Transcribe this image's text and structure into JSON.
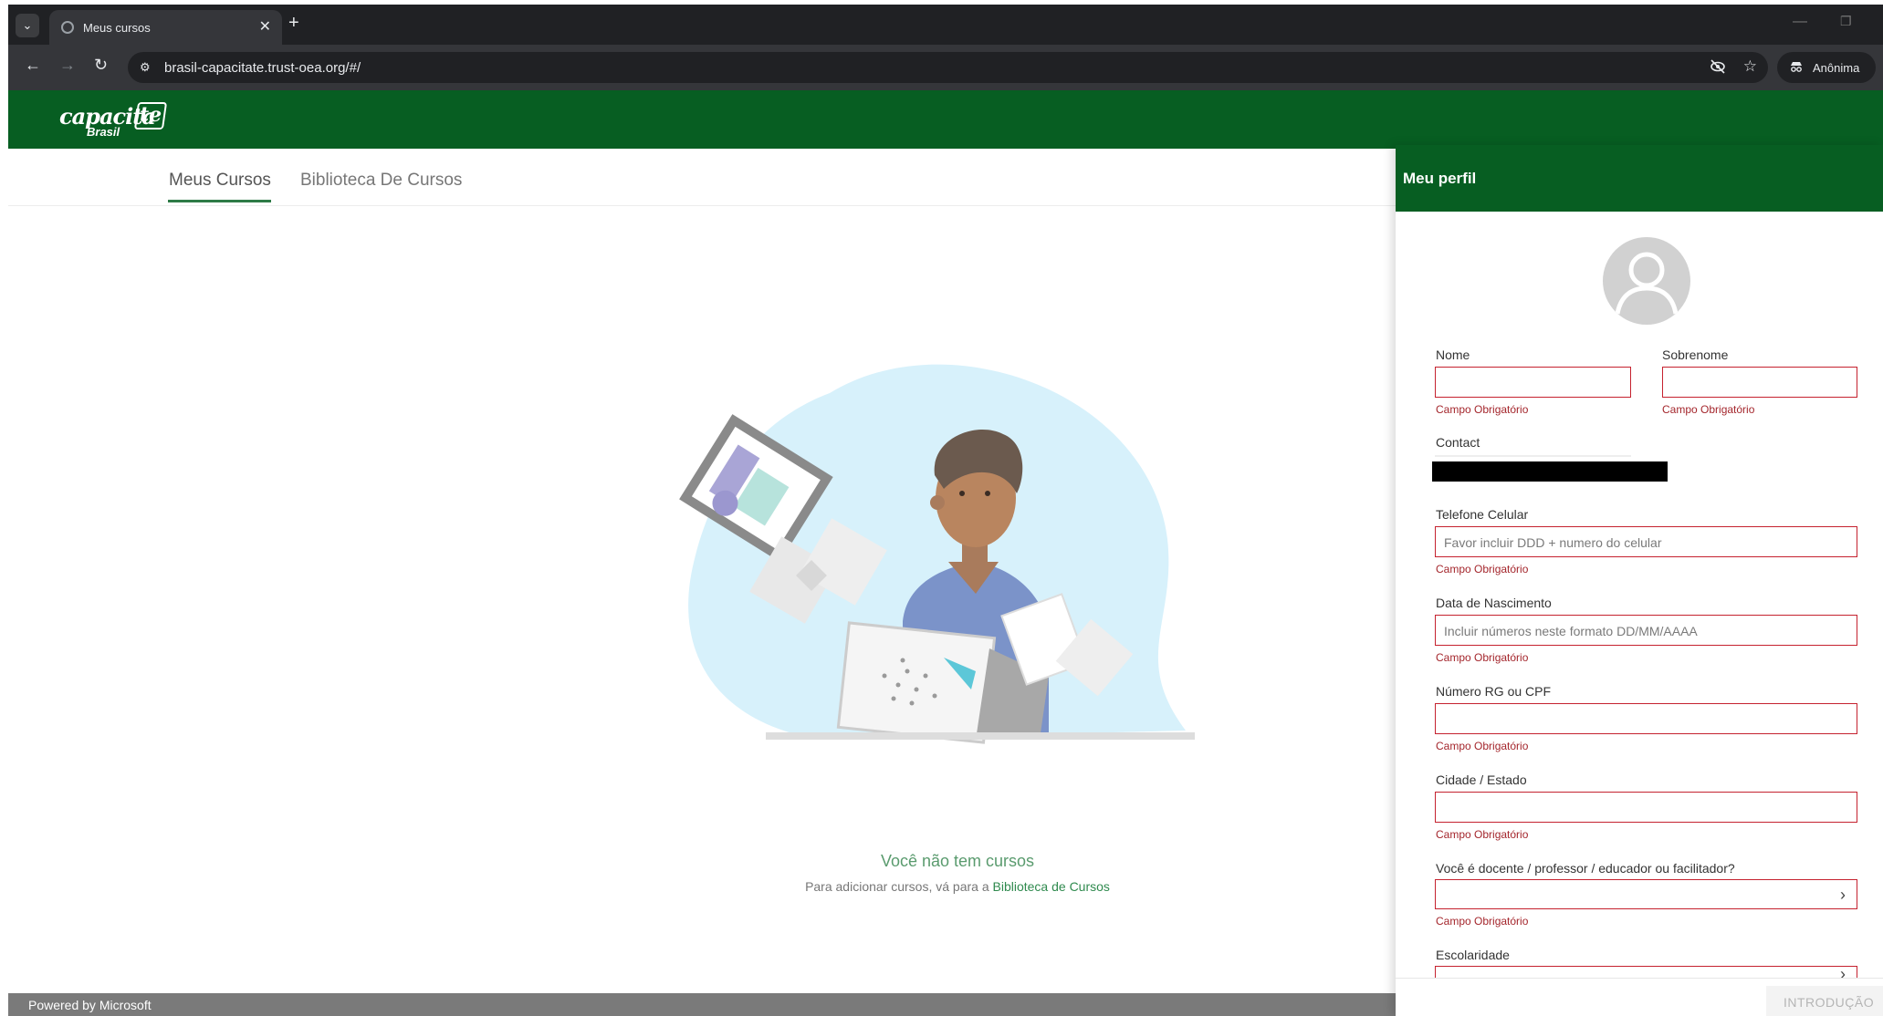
{
  "browser": {
    "tab_title": "Meus cursos",
    "url": "brasil-capacitate.trust-oea.org/#/",
    "profile_label": "Anônima"
  },
  "app": {
    "logo_main": "capacita",
    "logo_accent": "te",
    "logo_sub": "Brasil",
    "brand_color": "#075e22"
  },
  "nav": {
    "tabs": [
      "Meus Cursos",
      "Biblioteca De Cursos"
    ],
    "active_tab": "Meus Cursos"
  },
  "empty_state": {
    "title": "Você não tem cursos",
    "subtitle_prefix": "Para adicionar cursos, vá para a",
    "subtitle_link": "Biblioteca de Cursos"
  },
  "footer": {
    "text": "Powered by Microsoft"
  },
  "profile_panel": {
    "title": "Meu perfil",
    "required_text": "Campo Obrigatório",
    "fields": {
      "nome": {
        "label": "Nome",
        "value": ""
      },
      "sobrenome": {
        "label": "Sobrenome",
        "value": ""
      },
      "contact": {
        "label": "Contact"
      },
      "telefone": {
        "label": "Telefone Celular",
        "placeholder": "Favor incluir DDD + numero do celular"
      },
      "nascimento": {
        "label": "Data de Nascimento",
        "placeholder": "Incluir números neste formato DD/MM/AAAA"
      },
      "rg_cpf": {
        "label": "Número RG ou CPF",
        "value": ""
      },
      "cidade": {
        "label": "Cidade / Estado",
        "value": ""
      },
      "docente": {
        "label": "Você é docente / professor / educador ou facilitador?",
        "value": ""
      },
      "escolaridade": {
        "label": "Escolaridade",
        "value": ""
      }
    },
    "footer_button": "INTRODUÇÃO",
    "error_color": "#a4262c"
  }
}
